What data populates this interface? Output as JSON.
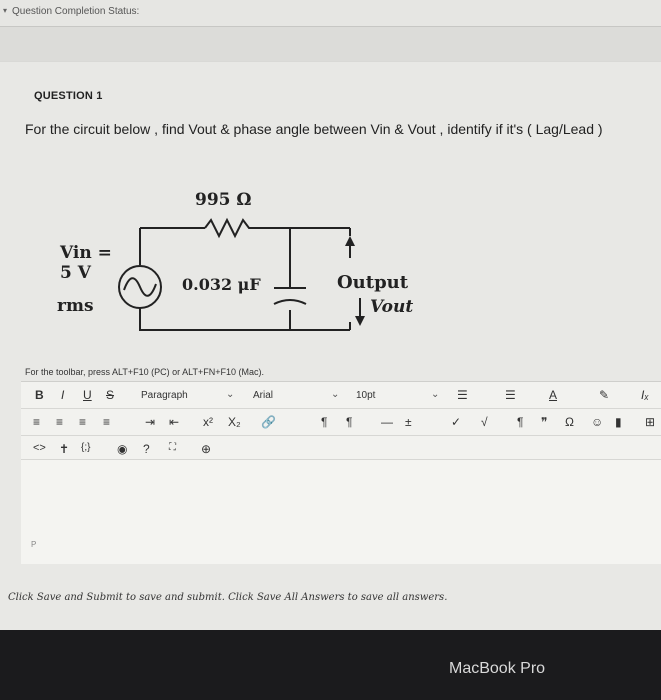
{
  "status": {
    "label": "Question Completion Status:"
  },
  "question": {
    "title": "QUESTION 1",
    "text": "For the circuit below , find Vout & phase angle between Vin & Vout , identify if it's ( Lag/Lead )"
  },
  "circuit": {
    "resistor": "995 Ω",
    "vin_line1": "Vin =",
    "vin_sub": "in",
    "vin_v": "5 V",
    "vin_rms": "rms",
    "capacitor": "0.032 μF",
    "output": "Output",
    "vout": "Vout",
    "vout_sub": "out"
  },
  "editor": {
    "hint": "For the toolbar, press ALT+F10 (PC) or ALT+FN+F10 (Mac).",
    "paragraph": "Paragraph",
    "font": "Arial",
    "size": "10pt",
    "p_tag": "P"
  },
  "footer": {
    "save_text": "Click Save and Submit to save and submit. Click Save All Answers to save all answers."
  },
  "device": {
    "brand": "MacBook Pro"
  }
}
